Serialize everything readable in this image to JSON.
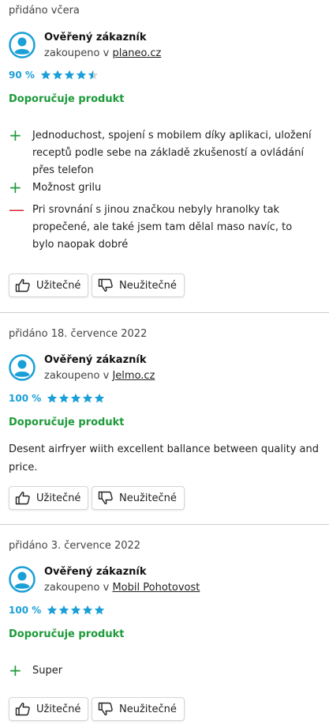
{
  "reviews": [
    {
      "date": "přidáno včera",
      "author": "Ověřený zákazník",
      "store_prefix": "zakoupeno v",
      "store_name": "planeo.cz",
      "percent": "90 %",
      "stars": 4.5,
      "recommend": "Doporučuje produkt",
      "pros": [
        "Jednoduchost, spojení s mobilem díky aplikaci, uložení receptů podle sebe na základě zkušeností a ovládání přes telefon",
        "Možnost grilu"
      ],
      "cons": [
        "Pri srovnání s jinou značkou nebyly hranolky tak propečené, ale také jsem tam dělal maso navíc, to bylo naopak dobré"
      ],
      "text": "",
      "useful_label": "Užitečné",
      "useless_label": "Neužitečné"
    },
    {
      "date": "přidáno 18. července 2022",
      "author": "Ověřený zákazník",
      "store_prefix": "zakoupeno v",
      "store_name": "Jelmo.cz",
      "percent": "100 %",
      "stars": 5,
      "recommend": "Doporučuje produkt",
      "pros": [],
      "cons": [],
      "text": "Desent airfryer wiith excellent ballance between quality and price.",
      "useful_label": "Užitečné",
      "useless_label": "Neužitečné"
    },
    {
      "date": "přidáno 3. července 2022",
      "author": "Ověřený zákazník",
      "store_prefix": "zakoupeno v",
      "store_name": "Mobil Pohotovost",
      "percent": "100 %",
      "stars": 5,
      "recommend": "Doporučuje produkt",
      "pros": [
        "Super"
      ],
      "cons": [],
      "text": "",
      "useful_label": "Užitečné",
      "useless_label": "Neužitečné"
    }
  ],
  "colors": {
    "accent_blue": "#1a9fd6",
    "recommend_green": "#1d9a3a",
    "con_red": "#d9202f"
  },
  "icons": {
    "avatar": "user-avatar-icon",
    "star": "star-icon",
    "pro": "plus-icon",
    "con": "minus-icon",
    "useful": "thumbs-up-icon",
    "useless": "thumbs-down-icon"
  }
}
